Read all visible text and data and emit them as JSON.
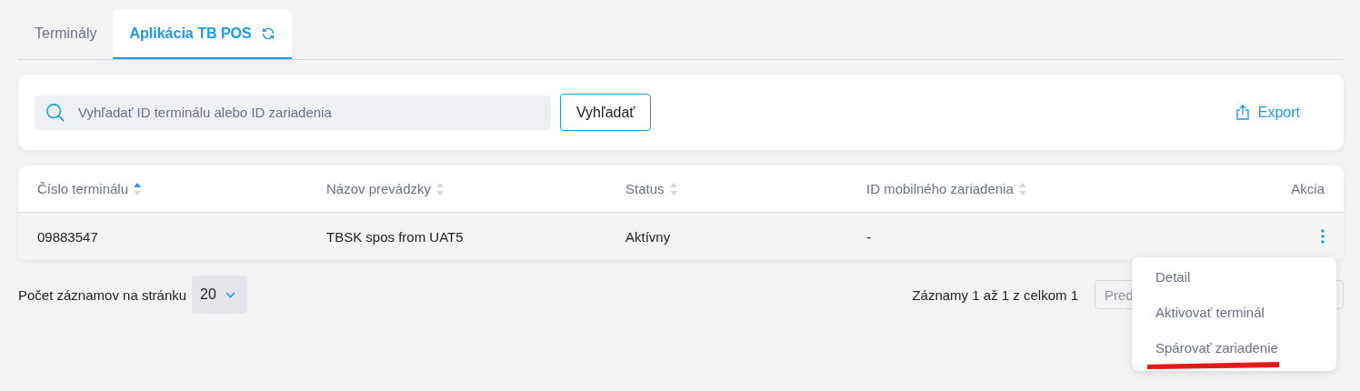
{
  "tabs": [
    {
      "label": "Terminály",
      "selected": false,
      "refresh": false
    },
    {
      "label": "Aplikácia TB POS",
      "selected": true,
      "refresh": true
    }
  ],
  "search": {
    "placeholder": "Vyhľadať ID terminálu alebo ID zariadenia",
    "button": "Vyhľadať",
    "export": "Export"
  },
  "table": {
    "columns": [
      {
        "label": "Číslo terminálu",
        "sorted": true
      },
      {
        "label": "Názov prevádzky",
        "sorted": false
      },
      {
        "label": "Status",
        "sorted": false
      },
      {
        "label": "ID mobilného zariadenia",
        "sorted": false
      },
      {
        "label": "Akcia"
      }
    ],
    "rows": [
      {
        "cells": [
          "09883547",
          "TBSK spos from UAT5",
          "Aktívny",
          "-"
        ]
      }
    ]
  },
  "pagination": {
    "per_page_label": "Počet záznamov na stránku",
    "per_page": "20",
    "summary": "Záznamy 1 až 1 z celkom 1",
    "prev": "Pred"
  },
  "menu": {
    "items": [
      {
        "label": "Detail",
        "marked": false
      },
      {
        "label": "Aktivovať terminál",
        "marked": false
      },
      {
        "label": "Spárovať zariadenie",
        "marked": true
      }
    ]
  }
}
